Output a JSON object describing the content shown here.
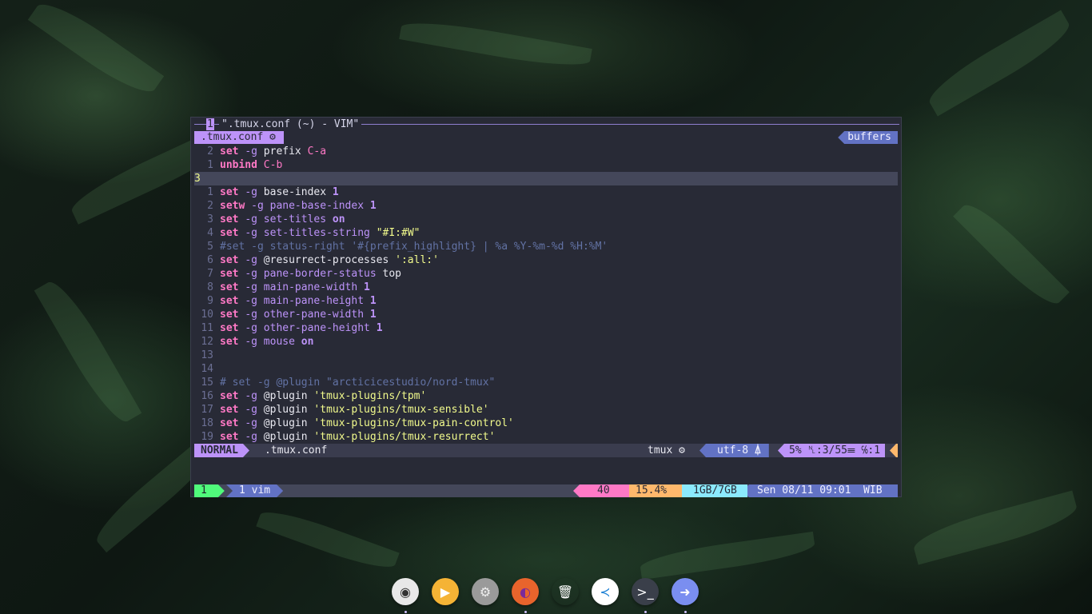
{
  "pane": {
    "index": "1",
    "title": "\".tmux.conf (~) - VIM\""
  },
  "vim_tabline": {
    "buffer_name": ".tmux.conf",
    "gear_glyph": "⚙",
    "right_label": "buffers"
  },
  "code_lines": [
    {
      "n": "2",
      "current": false,
      "tokens": [
        [
          "kw",
          "set"
        ],
        [
          "plain",
          " "
        ],
        [
          "opt",
          "-g"
        ],
        [
          "plain",
          " prefix "
        ],
        [
          "key",
          "C-a"
        ]
      ]
    },
    {
      "n": "1",
      "current": false,
      "tokens": [
        [
          "kw",
          "unbind"
        ],
        [
          "plain",
          " "
        ],
        [
          "key",
          "C-b"
        ]
      ]
    },
    {
      "n": "3",
      "current": true,
      "tokens": []
    },
    {
      "n": "1",
      "current": false,
      "tokens": [
        [
          "kw",
          "set"
        ],
        [
          "plain",
          " "
        ],
        [
          "opt",
          "-g"
        ],
        [
          "plain",
          " base-index "
        ],
        [
          "num",
          "1"
        ]
      ]
    },
    {
      "n": "2",
      "current": false,
      "tokens": [
        [
          "kw",
          "setw"
        ],
        [
          "plain",
          " "
        ],
        [
          "opt",
          "-g"
        ],
        [
          "plain",
          " "
        ],
        [
          "opt",
          "pane-base-index"
        ],
        [
          "plain",
          " "
        ],
        [
          "num",
          "1"
        ]
      ]
    },
    {
      "n": "3",
      "current": false,
      "tokens": [
        [
          "kw",
          "set"
        ],
        [
          "plain",
          " "
        ],
        [
          "opt",
          "-g"
        ],
        [
          "plain",
          " "
        ],
        [
          "opt",
          "set-titles"
        ],
        [
          "plain",
          " "
        ],
        [
          "num",
          "on"
        ]
      ]
    },
    {
      "n": "4",
      "current": false,
      "tokens": [
        [
          "kw",
          "set"
        ],
        [
          "plain",
          " "
        ],
        [
          "opt",
          "-g"
        ],
        [
          "plain",
          " "
        ],
        [
          "opt",
          "set-titles-string"
        ],
        [
          "plain",
          " "
        ],
        [
          "str",
          "\"#I:#W\""
        ]
      ]
    },
    {
      "n": "5",
      "current": false,
      "tokens": [
        [
          "cmt",
          "#set -g status-right '#{prefix_highlight} | %a %Y-%m-%d %H:%M'"
        ]
      ]
    },
    {
      "n": "6",
      "current": false,
      "tokens": [
        [
          "kw",
          "set"
        ],
        [
          "plain",
          " "
        ],
        [
          "opt",
          "-g"
        ],
        [
          "plain",
          " @resurrect-processes "
        ],
        [
          "str",
          "':all:'"
        ]
      ]
    },
    {
      "n": "7",
      "current": false,
      "tokens": [
        [
          "kw",
          "set"
        ],
        [
          "plain",
          " "
        ],
        [
          "opt",
          "-g"
        ],
        [
          "plain",
          " "
        ],
        [
          "opt",
          "pane-border-status"
        ],
        [
          "plain",
          " top"
        ]
      ]
    },
    {
      "n": "8",
      "current": false,
      "tokens": [
        [
          "kw",
          "set"
        ],
        [
          "plain",
          " "
        ],
        [
          "opt",
          "-g"
        ],
        [
          "plain",
          " "
        ],
        [
          "opt",
          "main-pane-width"
        ],
        [
          "plain",
          " "
        ],
        [
          "num",
          "1"
        ]
      ]
    },
    {
      "n": "9",
      "current": false,
      "tokens": [
        [
          "kw",
          "set"
        ],
        [
          "plain",
          " "
        ],
        [
          "opt",
          "-g"
        ],
        [
          "plain",
          " "
        ],
        [
          "opt",
          "main-pane-height"
        ],
        [
          "plain",
          " "
        ],
        [
          "num",
          "1"
        ]
      ]
    },
    {
      "n": "10",
      "current": false,
      "tokens": [
        [
          "kw",
          "set"
        ],
        [
          "plain",
          " "
        ],
        [
          "opt",
          "-g"
        ],
        [
          "plain",
          " "
        ],
        [
          "opt",
          "other-pane-width"
        ],
        [
          "plain",
          " "
        ],
        [
          "num",
          "1"
        ]
      ]
    },
    {
      "n": "11",
      "current": false,
      "tokens": [
        [
          "kw",
          "set"
        ],
        [
          "plain",
          " "
        ],
        [
          "opt",
          "-g"
        ],
        [
          "plain",
          " "
        ],
        [
          "opt",
          "other-pane-height"
        ],
        [
          "plain",
          " "
        ],
        [
          "num",
          "1"
        ]
      ]
    },
    {
      "n": "12",
      "current": false,
      "tokens": [
        [
          "kw",
          "set"
        ],
        [
          "plain",
          " "
        ],
        [
          "opt",
          "-g"
        ],
        [
          "plain",
          " "
        ],
        [
          "opt",
          "mouse"
        ],
        [
          "plain",
          " "
        ],
        [
          "num",
          "on"
        ]
      ]
    },
    {
      "n": "13",
      "current": false,
      "tokens": []
    },
    {
      "n": "14",
      "current": false,
      "tokens": []
    },
    {
      "n": "15",
      "current": false,
      "tokens": [
        [
          "cmt",
          "# set -g @plugin \"arcticicestudio/nord-tmux\""
        ]
      ]
    },
    {
      "n": "16",
      "current": false,
      "tokens": [
        [
          "kw",
          "set"
        ],
        [
          "plain",
          " "
        ],
        [
          "opt",
          "-g"
        ],
        [
          "plain",
          " @plugin "
        ],
        [
          "str",
          "'tmux-plugins/tpm'"
        ]
      ]
    },
    {
      "n": "17",
      "current": false,
      "tokens": [
        [
          "kw",
          "set"
        ],
        [
          "plain",
          " "
        ],
        [
          "opt",
          "-g"
        ],
        [
          "plain",
          " @plugin "
        ],
        [
          "str",
          "'tmux-plugins/tmux-sensible'"
        ]
      ]
    },
    {
      "n": "18",
      "current": false,
      "tokens": [
        [
          "kw",
          "set"
        ],
        [
          "plain",
          " "
        ],
        [
          "opt",
          "-g"
        ],
        [
          "plain",
          " @plugin "
        ],
        [
          "str",
          "'tmux-plugins/tmux-pain-control'"
        ]
      ]
    },
    {
      "n": "19",
      "current": false,
      "tokens": [
        [
          "kw",
          "set"
        ],
        [
          "plain",
          " "
        ],
        [
          "opt",
          "-g"
        ],
        [
          "plain",
          " @plugin "
        ],
        [
          "str",
          "'tmux-plugins/tmux-resurrect'"
        ]
      ]
    }
  ],
  "vim_status": {
    "mode": "NORMAL",
    "file": ".tmux.conf",
    "filetype": "tmux ⚙",
    "encoding": "utf-8 ⍋",
    "position": "5% ␤:3/55☰ ℅:1"
  },
  "tmux_status": {
    "session": "1",
    "window": "1 vim",
    "cpu": "40",
    "cpu_percent": "15.4%",
    "memory": "1GB/7GB",
    "clock": "Sen 08/11 09:01  WIB"
  },
  "dock": {
    "items": [
      {
        "name": "audio-player-icon",
        "glyph": "◉",
        "bg": "#e8e8e8",
        "fg": "#333333",
        "running": true
      },
      {
        "name": "video-player-icon",
        "glyph": "▶",
        "bg": "#f5b335",
        "fg": "#ffffff",
        "running": false
      },
      {
        "name": "settings-icon",
        "glyph": "⚙",
        "bg": "#9a9a9a",
        "fg": "#eeeeee",
        "running": false
      },
      {
        "name": "firefox-icon",
        "glyph": "◐",
        "bg": "#e8642c",
        "fg": "#7a2a9a",
        "running": true
      },
      {
        "name": "trash-icon",
        "glyph": "🗑",
        "bg": "transparent",
        "fg": "#ffffff",
        "running": false
      },
      {
        "name": "vscode-icon",
        "glyph": "≺",
        "bg": "#ffffff",
        "fg": "#1a7fd4",
        "running": false
      },
      {
        "name": "terminal-icon",
        "glyph": ">_",
        "bg": "#3a3f4a",
        "fg": "#ffffff",
        "running": true
      },
      {
        "name": "sourcegit-icon",
        "glyph": "➜",
        "bg": "#7a8ef0",
        "fg": "#ffffff",
        "running": true
      }
    ]
  }
}
